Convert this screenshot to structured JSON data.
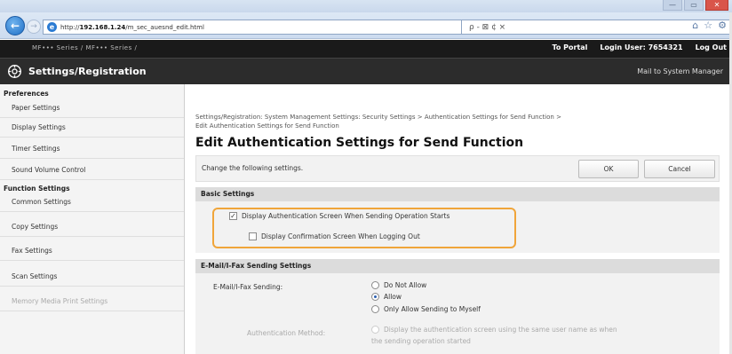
{
  "browser": {
    "url_prefix": "http://",
    "url_host": "192.168.1.24",
    "url_path": "/m_sec_auesnd_edit.html",
    "search_glyphs": "ρ - ⊠ ¢ ×",
    "win_min": "—",
    "win_max": "▭",
    "win_close": "✕"
  },
  "header": {
    "device_name": "MF••• Series / MF••• Series /",
    "to_portal": "To Portal",
    "login_user_label": "Login User:",
    "login_user_value": "7654321",
    "log_out": "Log Out",
    "app_title": "Settings/Registration",
    "mail_to": "Mail to System Manager"
  },
  "sidebar": {
    "preferences_heading": "Preferences",
    "preferences_items": [
      "Paper Settings",
      "Display Settings",
      "Timer Settings",
      "Sound Volume Control"
    ],
    "function_heading": "Function Settings",
    "function_items": [
      "Common Settings",
      "Copy Settings",
      "Fax Settings",
      "Scan Settings",
      "Memory Media Print Settings"
    ]
  },
  "main": {
    "breadcrumb_line1": "Settings/Registration: System Management Settings: Security Settings > Authentication Settings for Send Function >",
    "breadcrumb_line2": "Edit Authentication Settings for Send Function",
    "page_title": "Edit Authentication Settings for Send Function",
    "change_text": "Change the following settings.",
    "ok_label": "OK",
    "cancel_label": "Cancel",
    "basic_settings": {
      "heading": "Basic Settings",
      "display_auth_screen": {
        "label": "Display Authentication Screen When Sending Operation Starts",
        "checked": true
      },
      "display_confirmation": {
        "label": "Display Confirmation Screen When Logging Out",
        "checked": false
      }
    },
    "email_fax": {
      "heading": "E-Mail/I-Fax Sending Settings",
      "sending_label": "E-Mail/I-Fax Sending:",
      "sending_options": [
        "Do Not Allow",
        "Allow",
        "Only Allow Sending to Myself"
      ],
      "sending_selected": "Allow",
      "auth_method_label": "Authentication Method:",
      "auth_method_line1": "Display the authentication screen using the same user name as when",
      "auth_method_line2": "the sending operation started"
    }
  }
}
